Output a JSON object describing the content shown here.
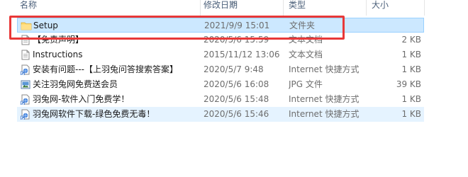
{
  "columns": {
    "name": "名称",
    "date": "修改日期",
    "type": "类型",
    "size": "大小"
  },
  "files": [
    {
      "name": "Setup",
      "date": "2021/9/9 15:01",
      "type": "文件夹",
      "size": "",
      "icon": "folder-icon",
      "state": "selected"
    },
    {
      "name": "【免责声明】",
      "date": "2020/5/6 15:59",
      "type": "文本文档",
      "size": "2 KB",
      "icon": "text-file-icon",
      "state": ""
    },
    {
      "name": "Instructions",
      "date": "2015/11/12 13:06",
      "type": "文本文档",
      "size": "1 KB",
      "icon": "text-file-icon",
      "state": ""
    },
    {
      "name": "安装有问题---【上羽兔问答搜索答案】",
      "date": "2020/5/7 9:48",
      "type": "Internet 快捷方式",
      "size": "1 KB",
      "icon": "internet-shortcut-icon",
      "state": ""
    },
    {
      "name": "关注羽兔网免费送会员",
      "date": "2020/5/6 16:08",
      "type": "JPG 文件",
      "size": "39 KB",
      "icon": "image-file-icon",
      "state": ""
    },
    {
      "name": "羽兔网-软件入门免费学！",
      "date": "2020/5/6 15:48",
      "type": "Internet 快捷方式",
      "size": "1 KB",
      "icon": "internet-shortcut-icon",
      "state": ""
    },
    {
      "name": "羽兔网软件下载-绿色免费无毒！",
      "date": "2020/5/6 15:46",
      "type": "Internet 快捷方式",
      "size": "1 KB",
      "icon": "internet-shortcut-icon",
      "state": "hover"
    }
  ],
  "colors": {
    "selection_bg": "#cce8ff",
    "selection_border": "#99d1ff",
    "hover_bg": "#e5f3ff",
    "annotation": "#e83838",
    "folder": "#ffd766"
  }
}
